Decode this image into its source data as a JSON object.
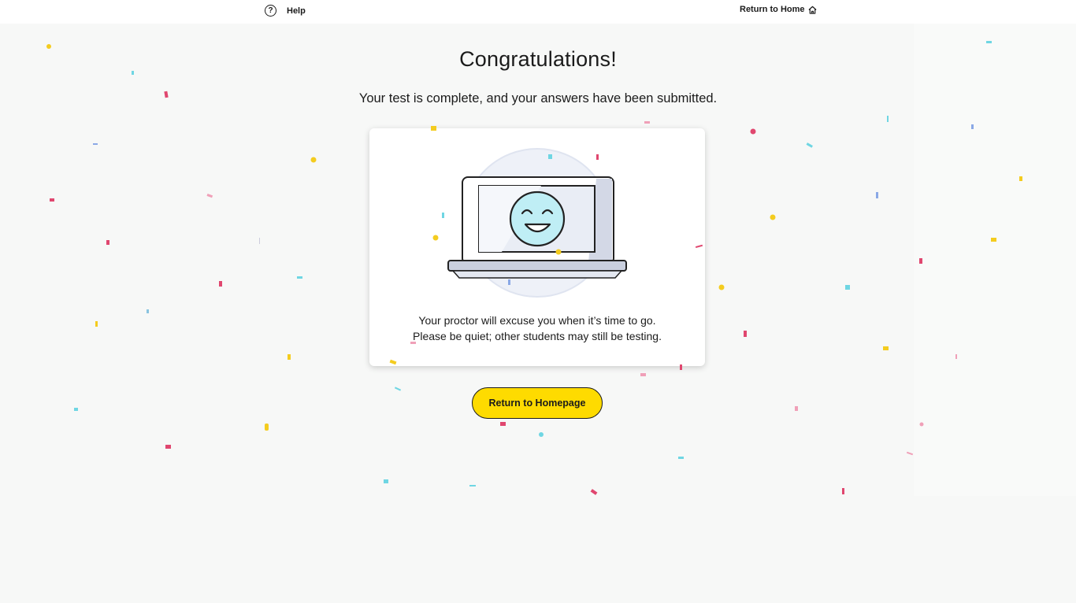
{
  "header": {
    "help_icon": "question-circle-icon",
    "help_label": "Help",
    "home_label": "Return to Home",
    "home_icon": "house-icon"
  },
  "main": {
    "title": "Congratulations!",
    "subtitle": "Your test is complete, and your answers have been submitted.",
    "card": {
      "illustration": "laptop-smiley-illustration",
      "line1": "Your proctor will excuse you when it’s time to go.",
      "line2": "Please be quiet; other students may still be testing."
    },
    "cta_label": "Return to Homepage"
  },
  "colors": {
    "background": "#f7f8f7",
    "accent_yellow": "#fedb00",
    "confetti_pink": "#e0476f",
    "confetti_cyan": "#6fd6e3",
    "confetti_blue": "#8aa8e6",
    "face_fill": "#bfeef5"
  }
}
